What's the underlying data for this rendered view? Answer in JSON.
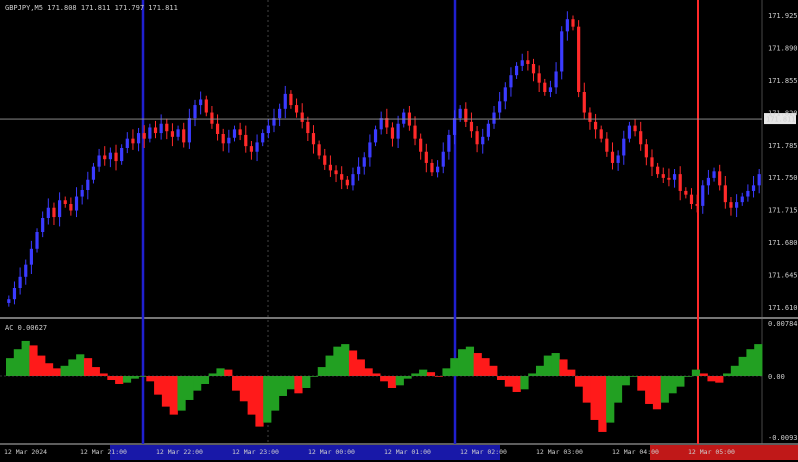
{
  "window": {
    "header_text": "GBPJPY,M5  171.808 171.811 171.797 171.811",
    "indicator_label": "AC 0.00627"
  },
  "colors": {
    "background": "#000000",
    "bull": "#3b3bff",
    "bear": "#ff2a2a",
    "ac_up": "#22a022",
    "ac_down": "#ff1a1a",
    "separator": "#2020d0",
    "red_vline": "#ff2a2a",
    "price_line": "#9a9a9a"
  },
  "price_axis": {
    "labels": [
      "171.925",
      "171.890",
      "171.855",
      "171.820",
      "171.785",
      "171.750",
      "171.715",
      "171.680",
      "171.645",
      "171.610"
    ],
    "current_price": "171.811"
  },
  "ac_axis": {
    "labels": [
      "0.00784",
      "0.00",
      "-0.00931"
    ]
  },
  "time_axis": {
    "labels": [
      "12 Mar 2024",
      "12 Mar 21:00",
      "12 Mar 22:00",
      "12 Mar 23:00",
      "12 Mar 00:00",
      "12 Mar 01:00",
      "12 Mar 02:00",
      "12 Mar 03:00",
      "12 Mar 04:00",
      "12 Mar 05:00"
    ]
  },
  "chart_data": {
    "type": "candlestick",
    "symbol": "GBPJPY",
    "timeframe": "M5",
    "ohlc_last": {
      "open": 171.808,
      "high": 171.811,
      "low": 171.797,
      "close": 171.811
    },
    "y_range": [
      171.6,
      171.93
    ],
    "closes": [
      171.618,
      171.63,
      171.642,
      171.655,
      171.672,
      171.69,
      171.705,
      171.716,
      171.706,
      171.724,
      171.72,
      171.713,
      171.728,
      171.735,
      171.746,
      171.76,
      171.772,
      171.768,
      171.775,
      171.766,
      171.78,
      171.79,
      171.785,
      171.796,
      171.79,
      171.802,
      171.796,
      171.806,
      171.798,
      171.792,
      171.8,
      171.786,
      171.812,
      171.826,
      171.832,
      171.818,
      171.806,
      171.795,
      171.785,
      171.791,
      171.8,
      171.794,
      171.782,
      171.776,
      171.786,
      171.796,
      171.804,
      171.812,
      171.822,
      171.838,
      171.826,
      171.818,
      171.808,
      171.796,
      171.784,
      171.772,
      171.762,
      171.756,
      171.752,
      171.746,
      171.74,
      171.752,
      171.76,
      171.77,
      171.786,
      171.8,
      171.812,
      171.802,
      171.79,
      171.806,
      171.818,
      171.804,
      171.79,
      171.776,
      171.764,
      171.754,
      171.76,
      171.776,
      171.794,
      171.812,
      171.822,
      171.808,
      171.798,
      171.784,
      171.792,
      171.806,
      171.818,
      171.83,
      171.845,
      171.858,
      171.868,
      171.874,
      171.87,
      171.86,
      171.85,
      171.84,
      171.845,
      171.862,
      171.905,
      171.918,
      171.91,
      171.84,
      171.818,
      171.808,
      171.8,
      171.79,
      171.776,
      171.764,
      171.772,
      171.79,
      171.804,
      171.798,
      171.784,
      171.77,
      171.76,
      171.752,
      171.748,
      171.746,
      171.752,
      171.734,
      171.73,
      171.72,
      171.718,
      171.74,
      171.748,
      171.755,
      171.74,
      171.722,
      171.716,
      171.722,
      171.728,
      171.734,
      171.74,
      171.752
    ]
  },
  "ac_data": {
    "type": "bar",
    "y_range": [
      -0.00931,
      0.00784
    ],
    "values": [
      0.0028,
      0.0042,
      0.0055,
      0.0048,
      0.0032,
      0.002,
      0.0012,
      0.0016,
      0.0026,
      0.0034,
      0.0028,
      0.0014,
      0.0004,
      -0.0006,
      -0.0012,
      -0.001,
      -0.0004,
      0.0,
      -0.0008,
      -0.0028,
      -0.0046,
      -0.0058,
      -0.0052,
      -0.0036,
      -0.0022,
      -0.0012,
      0.0004,
      0.0012,
      0.001,
      -0.0022,
      -0.0038,
      -0.0058,
      -0.0076,
      -0.007,
      -0.0052,
      -0.003,
      -0.002,
      -0.0026,
      -0.0018,
      0.0,
      0.0014,
      0.0032,
      0.0046,
      0.005,
      0.004,
      0.0026,
      0.0012,
      0.0004,
      -0.0008,
      -0.0018,
      -0.0014,
      -0.0004,
      0.0004,
      0.001,
      0.0006,
      0.0,
      0.0012,
      0.0028,
      0.0042,
      0.0046,
      0.0036,
      0.0028,
      0.0016,
      -0.0006,
      -0.0016,
      -0.0024,
      -0.002,
      0.0004,
      0.0016,
      0.0032,
      0.0036,
      0.0026,
      0.001,
      -0.0016,
      -0.004,
      -0.0066,
      -0.0084,
      -0.007,
      -0.004,
      -0.0014,
      0.0,
      -0.0022,
      -0.0042,
      -0.005,
      -0.004,
      -0.0026,
      -0.0016,
      0.0,
      0.001,
      0.0004,
      -0.0008,
      -0.001,
      0.0004,
      0.0016,
      0.003,
      0.0042,
      0.005
    ]
  }
}
